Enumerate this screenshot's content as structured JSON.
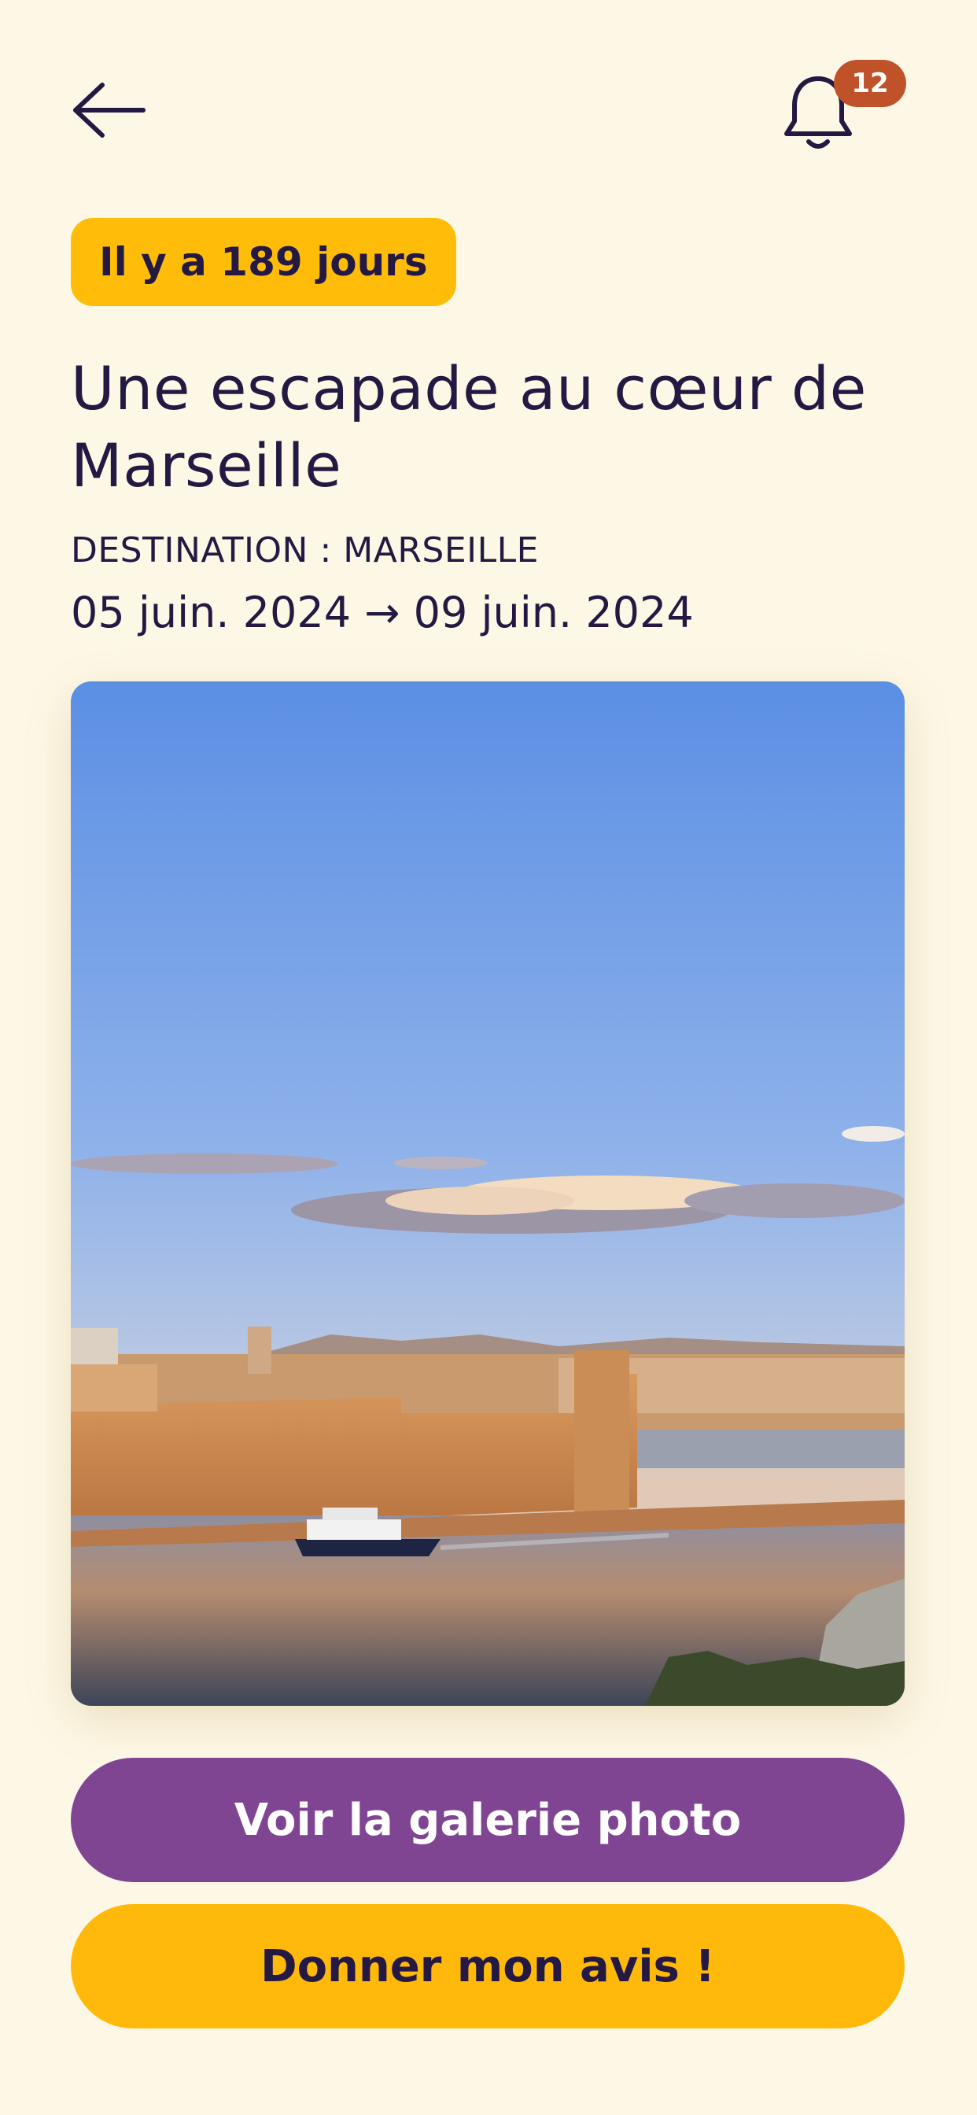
{
  "header": {
    "back_icon": "arrow-left-icon",
    "notifications_icon": "bell-icon",
    "notifications_count": "12",
    "badge_color": "#c0522a"
  },
  "trip": {
    "elapsed_label": "Il y a 189 jours",
    "title": "Une escapade au cœur de Marseille",
    "destination": "DESTINATION : MARSEILLE",
    "dates": "05 juin. 2024 → 09 juin. 2024"
  },
  "actions": {
    "gallery_label": "Voir la galerie photo",
    "review_label": "Donner mon avis !"
  },
  "colors": {
    "background": "#fdf8e6",
    "text": "#231942",
    "accent_yellow": "#ffbd0a",
    "accent_purple": "#7f4593"
  }
}
